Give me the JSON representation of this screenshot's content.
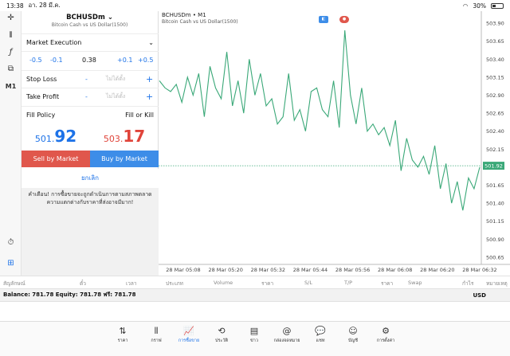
{
  "status_bar": {
    "time": "13:38",
    "date": "อา. 28 มี.ค.",
    "battery": "30%"
  },
  "left_toolbar": {
    "timeframe": "M1"
  },
  "order_panel": {
    "symbol": "BCHUSDm",
    "symbol_desc": "Bitcoin Cash vs US Dollar(1500)",
    "execution": "Market Execution",
    "volume": {
      "minus_big": "-0.5",
      "minus_small": "-0.1",
      "value": "0.38",
      "plus_small": "+0.1",
      "plus_big": "+0.5"
    },
    "stop_loss": {
      "label": "Stop Loss",
      "minus": "-",
      "value": "ไม่ได้ตั้ง",
      "plus": "+"
    },
    "take_profit": {
      "label": "Take Profit",
      "minus": "-",
      "value": "ไม่ได้ตั้ง",
      "plus": "+"
    },
    "fill_policy": {
      "label": "Fill Policy",
      "value": "Fill or Kill"
    },
    "sell_price": {
      "small": "501.",
      "big": "92"
    },
    "buy_price": {
      "small": "503.",
      "big": "17"
    },
    "sell_button": "Sell by Market",
    "buy_button": "Buy by Market",
    "cancel": "ยกเลิก",
    "warning": "คำเตือน! การซื้อขายจะถูกดำเนินการตามสภาพตลาด ความแตกต่างกับราคาที่ส่งอาจมีมาก!"
  },
  "chart_data": {
    "type": "line",
    "title": "BCHUSDm • M1",
    "subtitle": "Bitcoin Cash vs US Dollar(1500)",
    "x_ticks": [
      "28 Mar 05:08",
      "28 Mar 05:20",
      "28 Mar 05:32",
      "28 Mar 05:44",
      "28 Mar 05:56",
      "28 Mar 06:08",
      "28 Mar 06:20",
      "28 Mar 06:32"
    ],
    "y_ticks": [
      "503.90",
      "503.65",
      "503.40",
      "503.15",
      "502.90",
      "502.65",
      "502.40",
      "502.15",
      "501.90",
      "501.65",
      "501.40",
      "501.15",
      "500.90",
      "500.65"
    ],
    "ylim": [
      500.55,
      504.0
    ],
    "current_price": "501.92",
    "series": [
      {
        "values": [
          503.1,
          503.0,
          502.95,
          503.05,
          502.8,
          503.15,
          502.9,
          503.2,
          502.6,
          503.3,
          503.0,
          502.85,
          503.5,
          502.75,
          503.1,
          502.65,
          503.4,
          502.9,
          503.2,
          502.75,
          502.85,
          502.5,
          502.6,
          503.2,
          502.55,
          502.7,
          502.4,
          502.95,
          503.0,
          502.7,
          502.6,
          503.1,
          502.45,
          503.8,
          502.9,
          502.5,
          503.0,
          502.4,
          502.5,
          502.35,
          502.45,
          502.2,
          502.55,
          501.85,
          502.3,
          502.0,
          501.9,
          502.05,
          501.8,
          502.2,
          501.6,
          501.95,
          501.4,
          501.7,
          501.3,
          501.75,
          501.6,
          501.9
        ]
      }
    ]
  },
  "table_columns": [
    "สัญลักษณ์",
    "ตั๋ว",
    "เวลา",
    "ประเภท",
    "Volume",
    "ราคา",
    "S/L",
    "T/P",
    "ราคา",
    "Swap",
    "กำไร",
    "หมายเหตุ"
  ],
  "balance": {
    "text": "Balance: 781.78 Equity: 781.78 ฟรี: 781.78",
    "currency": "USD"
  },
  "tabs": [
    {
      "label": "ราคา",
      "icon": "⇅"
    },
    {
      "label": "กราฟ",
      "icon": "⫴"
    },
    {
      "label": "การซื้อขาย",
      "icon": "📈"
    },
    {
      "label": "ประวัติ",
      "icon": "⟲"
    },
    {
      "label": "ข่าว",
      "icon": "▤"
    },
    {
      "label": "กล่องจดหมาย",
      "icon": "@"
    },
    {
      "label": "แชท",
      "icon": "💬"
    },
    {
      "label": "บัญชี",
      "icon": "☺"
    },
    {
      "label": "การตั้งค่า",
      "icon": "⚙"
    }
  ]
}
